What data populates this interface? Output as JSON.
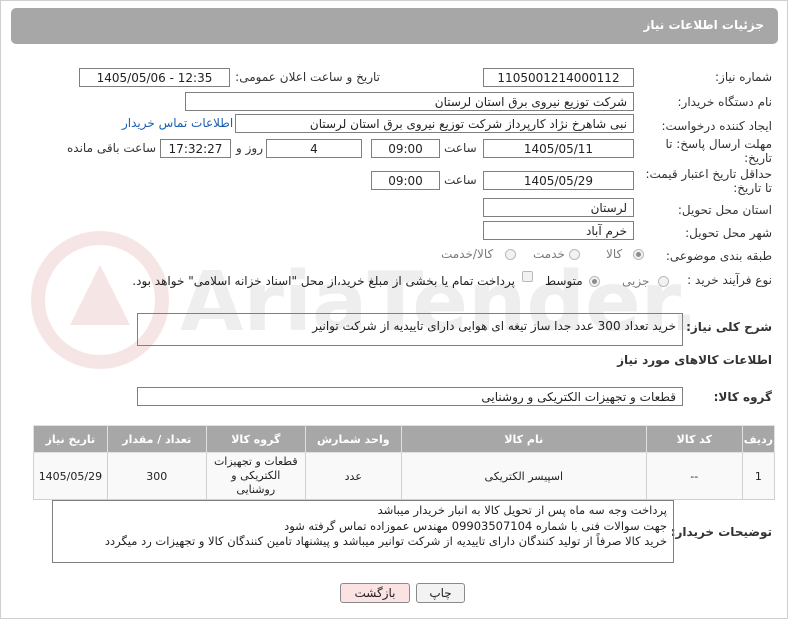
{
  "header": {
    "title": "جزئیات اطلاعات نیاز"
  },
  "fields": {
    "need_number_label": "شماره نیاز:",
    "need_number": "1105001214000112",
    "announce_label": "تاریخ و ساعت اعلان عمومی:",
    "announce_value": "1405/05/06 - 12:35",
    "buyer_org_label": "نام دستگاه خریدار:",
    "buyer_org": "شرکت توزیع نیروی برق استان لرستان",
    "creator_label": "ایجاد کننده درخواست:",
    "creator": "نبی شاهرخ نژاد کارپرداز شرکت توزیع نیروی برق استان لرستان",
    "contact_link": "اطلاعات تماس خریدار",
    "deadline_label": "مهلت ارسال پاسخ: تا تاریخ:",
    "deadline_date": "1405/05/11",
    "time_label": "ساعت",
    "deadline_time": "09:00",
    "days_value": "4",
    "days_label": "روز و",
    "remaining_time": "17:32:27",
    "remaining_label": "ساعت باقی مانده",
    "price_validity_label": "حداقل تاریخ اعتبار قیمت: تا تاریخ:",
    "price_validity_date": "1405/05/29",
    "price_validity_time": "09:00",
    "province_label": "استان محل تحویل:",
    "province": "لرستان",
    "city_label": "شهر محل تحویل:",
    "city": "خرم آباد",
    "category_label": "طبقه بندی موضوعی:",
    "category_options": [
      "کالا",
      "خدمت",
      "کالا/خدمت"
    ],
    "purchase_type_label": "نوع فرآیند خرید :",
    "purchase_options": [
      "جزیی",
      "متوسط"
    ],
    "payment_note": "پرداخت تمام یا بخشی از مبلغ خرید،از محل \"اسناد خزانه اسلامی\" خواهد بود.",
    "description_label": "شرح کلی نیاز:",
    "description": "خرید تعداد 300 عدد جدا ساز تیغه ای هوایی دارای تاییدیه از شرکت توانیر",
    "goods_info_title": "اطلاعات کالاهای مورد نیاز",
    "goods_group_label": "گروه کالا:",
    "goods_group": "قطعات و تجهیزات الکتریکی و روشنایی"
  },
  "table": {
    "headers": [
      "ردیف",
      "کد کالا",
      "نام کالا",
      "واحد شمارش",
      "گروه کالا",
      "تعداد / مقدار",
      "تاریخ نیاز"
    ],
    "rows": [
      [
        "1",
        "--",
        "اسپیسر الکتریکی",
        "عدد",
        "قطعات و تجهیزات الکتریکی و روشنایی",
        "300",
        "1405/05/29"
      ]
    ]
  },
  "notes": {
    "label": "توضیحات خریدار:",
    "line1": "پرداخت وجه سه ماه پس از تحویل کالا  به انبار خریدار میباشد",
    "line2": "جهت سوالات فنی با شماره 09903507104 مهندس عموزاده تماس گرفته شود",
    "line3": "خرید کالا صرفاً از تولید کنندگان دارای تاییدیه از شرکت توانیر میباشد و پیشنهاد تامین کنندگان کالا و تجهیزات رد میگردد"
  },
  "buttons": {
    "print": "چاپ",
    "back": "بازگشت"
  },
  "watermark": "AriaTender.net",
  "colors": {
    "header_bg": "#a7a7a7",
    "link": "#1a5fb4",
    "back_btn_bg": "#fbe3e3"
  }
}
